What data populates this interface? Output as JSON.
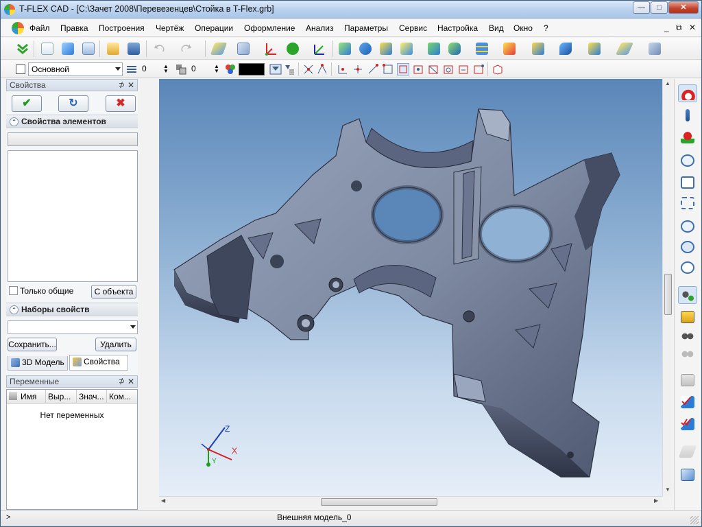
{
  "window": {
    "title": "T-FLEX CAD - [C:\\Зачет 2008\\Перевезенцев\\Стойка в T-Flex.grb]",
    "controls": {
      "minimize": "—",
      "maximize": "□",
      "close": "✕"
    }
  },
  "menu": {
    "items": [
      "Файл",
      "Правка",
      "Построения",
      "Чертёж",
      "Операции",
      "Оформление",
      "Анализ",
      "Параметры",
      "Сервис",
      "Настройка",
      "Вид",
      "Окно",
      "?"
    ],
    "mdi_controls": {
      "minimize": "_",
      "restore": "⧉",
      "close": "✕"
    }
  },
  "toolbar2": {
    "layer_value": "Основной",
    "level_value": "0",
    "priority_value": "0",
    "color_value": "#000000"
  },
  "properties_panel": {
    "title": "Свойства",
    "pin": "⊅",
    "close": "✕",
    "ok_icon": "✔",
    "refresh_icon": "↻",
    "cancel_icon": "✖",
    "section_elements": "Свойства элементов",
    "only_common_label": "Только общие",
    "from_object_button": "С объекта",
    "section_sets": "Наборы свойств",
    "save_button": "Сохранить...",
    "delete_button": "Удалить"
  },
  "tabs": [
    {
      "label": "3D Модель"
    },
    {
      "label": "Свойства"
    }
  ],
  "variables_panel": {
    "title": "Переменные",
    "columns": [
      "Имя",
      "Выр...",
      "Знач...",
      "Ком..."
    ],
    "empty_text": "Нет переменных"
  },
  "axes": {
    "z": "Z",
    "x": "X",
    "y": "Y"
  },
  "status": {
    "prompt": ">",
    "model_name": "Внешняя модель_0"
  },
  "colors": {
    "accent": "#3d5e86",
    "model_fill": "#7f8ba3",
    "viewport_top": "#5a86b8",
    "viewport_bottom": "#e6eef8"
  }
}
